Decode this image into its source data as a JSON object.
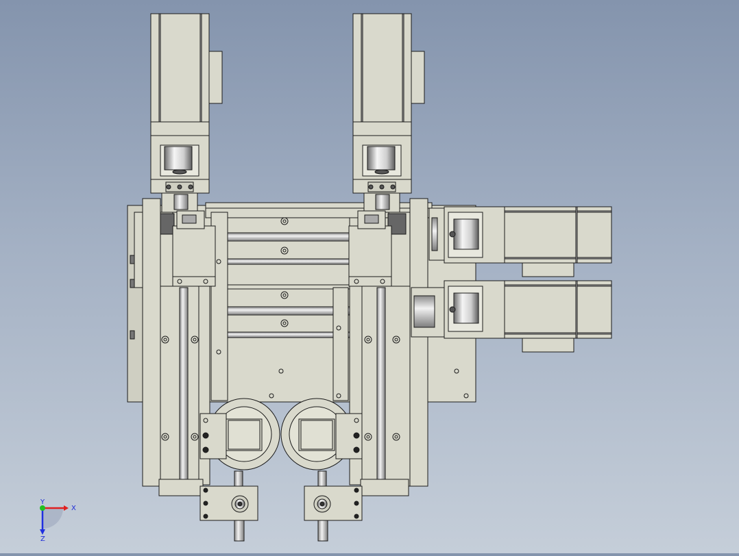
{
  "view": {
    "title": ""
  },
  "triad": {
    "x_label": "X",
    "y_label": "Y",
    "z_label": "Z",
    "x_color": "#e02020",
    "y_color": "#20c020",
    "z_color": "#2030e0"
  },
  "colors": {
    "part_fill": "#d9d9cc",
    "part_dark": "#b8b8aa",
    "edge": "#1a1a1a",
    "shaft": "#bfbfbf"
  }
}
